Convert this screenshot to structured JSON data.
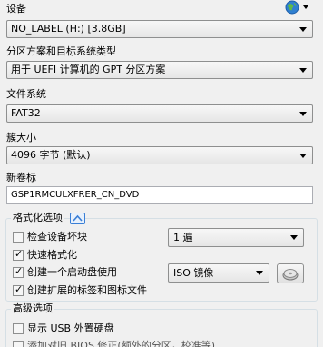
{
  "device": {
    "label": "设备",
    "value": "NO_LABEL (H:) [3.8GB]"
  },
  "partition": {
    "label": "分区方案和目标系统类型",
    "value": "用于 UEFI 计算机的 GPT 分区方案"
  },
  "filesystem": {
    "label": "文件系统",
    "value": "FAT32"
  },
  "cluster": {
    "label": "簇大小",
    "value": "4096 字节 (默认)"
  },
  "volume": {
    "label": "新卷标",
    "value": "GSP1RMCULXFRER_CN_DVD"
  },
  "format_options": {
    "title": "格式化选项",
    "check_bad_blocks": {
      "label": "检查设备坏块",
      "checked": false,
      "passes": "1 遍"
    },
    "quick_format": {
      "label": "快速格式化",
      "checked": true
    },
    "bootable": {
      "label": "创建一个启动盘使用",
      "checked": true,
      "image_type": "ISO 镜像"
    },
    "extended_label": {
      "label": "创建扩展的标签和图标文件",
      "checked": true
    }
  },
  "advanced_options": {
    "title": "高级选项",
    "show_usb": {
      "label": "显示 USB 外置硬盘",
      "checked": false
    },
    "bios_fix": {
      "label": "添加对旧 BIOS 修正(额外的分区，校准等)",
      "checked": false
    }
  },
  "icons": {
    "globe": "globe-icon",
    "disc": "disc-drive-icon",
    "toggle": "chevron-up-icon"
  },
  "colors": {
    "window_bg": "#f0f0f0",
    "group_border": "#d5dfe5",
    "toggle_blue": "#3a7fd6"
  }
}
